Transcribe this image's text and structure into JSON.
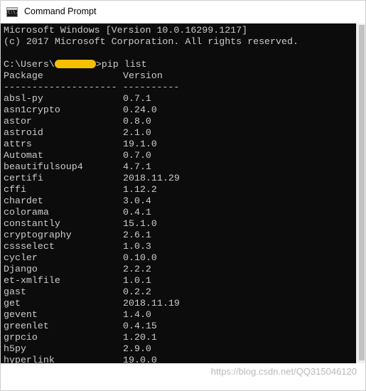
{
  "window": {
    "title": "Command Prompt",
    "icon_text": "C:\\."
  },
  "console": {
    "header_lines": [
      "Microsoft Windows [Version 10.0.16299.1217]",
      "(c) 2017 Microsoft Corporation. All rights reserved."
    ],
    "prompt": "C:\\Users\\",
    "command": ">pip list",
    "column_headers": {
      "package": "Package",
      "version": "Version"
    },
    "separator": "-------------------- ----------",
    "packages": [
      {
        "name": "absl-py",
        "version": "0.7.1"
      },
      {
        "name": "asn1crypto",
        "version": "0.24.0"
      },
      {
        "name": "astor",
        "version": "0.8.0"
      },
      {
        "name": "astroid",
        "version": "2.1.0"
      },
      {
        "name": "attrs",
        "version": "19.1.0"
      },
      {
        "name": "Automat",
        "version": "0.7.0"
      },
      {
        "name": "beautifulsoup4",
        "version": "4.7.1"
      },
      {
        "name": "certifi",
        "version": "2018.11.29"
      },
      {
        "name": "cffi",
        "version": "1.12.2"
      },
      {
        "name": "chardet",
        "version": "3.0.4"
      },
      {
        "name": "colorama",
        "version": "0.4.1"
      },
      {
        "name": "constantly",
        "version": "15.1.0"
      },
      {
        "name": "cryptography",
        "version": "2.6.1"
      },
      {
        "name": "cssselect",
        "version": "1.0.3"
      },
      {
        "name": "cycler",
        "version": "0.10.0"
      },
      {
        "name": "Django",
        "version": "2.2.2"
      },
      {
        "name": "et-xmlfile",
        "version": "1.0.1"
      },
      {
        "name": "gast",
        "version": "0.2.2"
      },
      {
        "name": "get",
        "version": "2018.11.19"
      },
      {
        "name": "gevent",
        "version": "1.4.0"
      },
      {
        "name": "greenlet",
        "version": "0.4.15"
      },
      {
        "name": "grpcio",
        "version": "1.20.1"
      },
      {
        "name": "h5py",
        "version": "2.9.0"
      },
      {
        "name": "hyperlink",
        "version": "19.0.0"
      }
    ]
  },
  "watermark": "https://blog.csdn.net/QQ315046120",
  "colors": {
    "console_bg": "#0c0c0c",
    "console_text": "#cccccc",
    "redaction": "#f5c000"
  }
}
